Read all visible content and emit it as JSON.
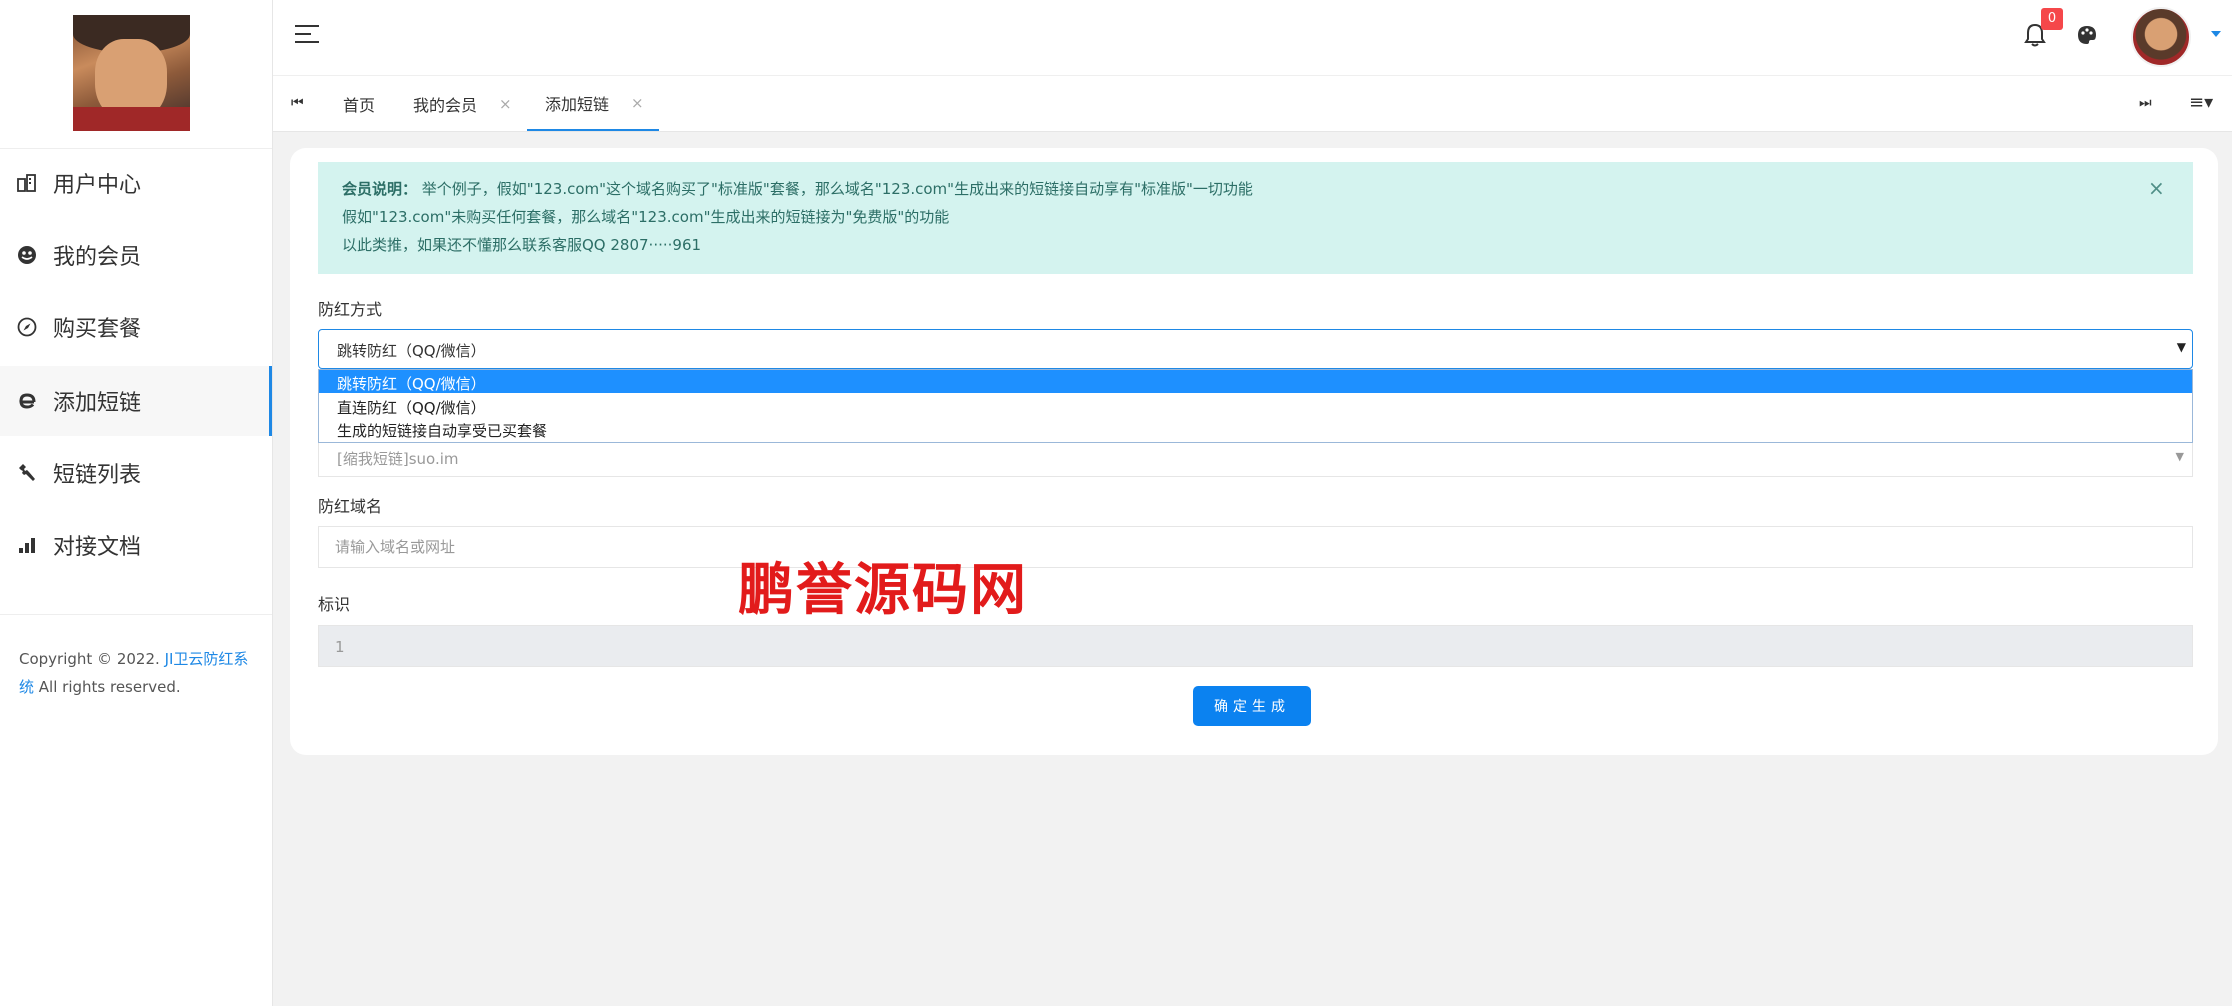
{
  "sidebar": {
    "items": [
      {
        "label": "用户中心",
        "icon": "dashboard-icon"
      },
      {
        "label": "我的会员",
        "icon": "member-icon"
      },
      {
        "label": "购买套餐",
        "icon": "compass-icon"
      },
      {
        "label": "添加短链",
        "icon": "browser-e-icon"
      },
      {
        "label": "短链列表",
        "icon": "wrench-icon"
      },
      {
        "label": "对接文档",
        "icon": "bar-chart-icon"
      }
    ],
    "active_index": 3,
    "copyright_prefix": "Copyright © 2022.",
    "copyright_link": "JI卫云防红系统",
    "copyright_suffix": "All rights reserved."
  },
  "header": {
    "notification_count": "0"
  },
  "tabs": [
    {
      "label": "首页",
      "closable": false
    },
    {
      "label": "我的会员",
      "closable": true
    },
    {
      "label": "添加短链",
      "closable": true,
      "active": true
    }
  ],
  "alert": {
    "title": "会员说明：",
    "line1": "举个例子，假如\"123.com\"这个域名购买了\"标准版\"套餐，那么域名\"123.com\"生成出来的短链接自动享有\"标准版\"一切功能",
    "line2": "假如\"123.com\"未购买任何套餐，那么域名\"123.com\"生成出来的短链接为\"免费版\"的功能",
    "line3": "以此类推，如果还不懂那么联系客服QQ 2807·····961"
  },
  "form": {
    "method_label": "防红方式",
    "method_value": "跳转防红（QQ/微信）",
    "method_options": [
      "跳转防红（QQ/微信）",
      "直连防红（QQ/微信）",
      "生成的短链接自动享受已买套餐"
    ],
    "shortener_value": "[缩我短链]suo.im",
    "domain_label": "防红域名",
    "domain_placeholder": "请输入域名或网址",
    "tag_label": "标识",
    "tag_value": "1",
    "submit_label": "确定生成"
  },
  "watermark": "鹏誉源码网",
  "colors": {
    "accent": "#1e88e5",
    "alert_bg": "#d4f3ef",
    "badge": "#f5474a",
    "watermark": "#e21b1b"
  }
}
